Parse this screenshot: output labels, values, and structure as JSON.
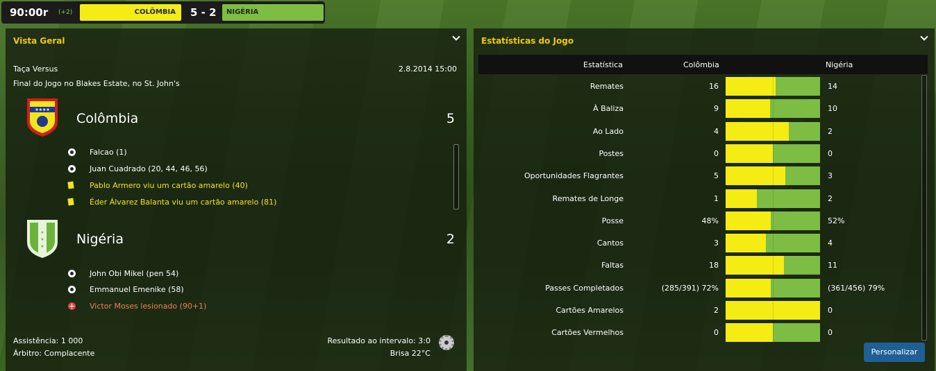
{
  "scorebar": {
    "time": "90:00r",
    "added": "(+2)",
    "home_team": "COLÔMBIA",
    "away_team": "NIGÉRIA",
    "score": "5 - 2"
  },
  "overview": {
    "title": "Vista Geral",
    "competition": "Taça Versus",
    "datetime": "2.8.2014 15:00",
    "venue": "Final do Jogo no Blakes Estate, no St. John's",
    "home": {
      "name": "Colômbia",
      "score": "5",
      "events": [
        {
          "type": "goal",
          "text": "Falcao (1)"
        },
        {
          "type": "goal",
          "text": "Juan Cuadrado (20, 44, 46, 56)"
        },
        {
          "type": "yellow",
          "text": "Pablo Armero viu um cartão amarelo (40)"
        },
        {
          "type": "yellow",
          "text": "Éder Álvarez Balanta viu um cartão amarelo (81)"
        }
      ]
    },
    "away": {
      "name": "Nigéria",
      "score": "2",
      "events": [
        {
          "type": "goal",
          "text": "John Obi Mikel (pen 54)"
        },
        {
          "type": "goal",
          "text": "Emmanuel Emenike (58)"
        },
        {
          "type": "injury",
          "text": "Victor Moses lesionado (90+1)"
        }
      ]
    },
    "attendance": "Assistência: 1 000",
    "referee": "Árbitro: Complacente",
    "halftime": "Resultado ao intervalo: 3:0",
    "weather": "Brisa 22°C"
  },
  "stats": {
    "title": "Estatísticas do Jogo",
    "headers": {
      "stat": "Estatística",
      "home": "Colômbia",
      "away": "Nigéria"
    },
    "rows": [
      {
        "label": "Remates",
        "home": "16",
        "away": "14",
        "home_share": 0.53
      },
      {
        "label": "À Baliza",
        "home": "9",
        "away": "10",
        "home_share": 0.47
      },
      {
        "label": "Ao Lado",
        "home": "4",
        "away": "2",
        "home_share": 0.67
      },
      {
        "label": "Postes",
        "home": "0",
        "away": "0",
        "home_share": 0.5
      },
      {
        "label": "Oportunidades Flagrantes",
        "home": "5",
        "away": "3",
        "home_share": 0.63
      },
      {
        "label": "Remates de Longe",
        "home": "1",
        "away": "2",
        "home_share": 0.33
      },
      {
        "label": "Posse",
        "home": "48%",
        "away": "52%",
        "home_share": 0.48
      },
      {
        "label": "Cantos",
        "home": "3",
        "away": "4",
        "home_share": 0.43
      },
      {
        "label": "Faltas",
        "home": "18",
        "away": "11",
        "home_share": 0.62
      },
      {
        "label": "Passes Completados",
        "home": "(285/391) 72%",
        "away": "(361/456) 79%",
        "home_share": 0.48
      },
      {
        "label": "Cartões Amarelos",
        "home": "2",
        "away": "0",
        "home_share": 1.0
      },
      {
        "label": "Cartões Vermelhos",
        "home": "0",
        "away": "0",
        "home_share": 0.5
      }
    ],
    "customize_label": "Personalizar"
  },
  "colors": {
    "home": "#f4ec13",
    "away": "#7dbd43",
    "accent_title": "#f4c80e",
    "button": "#1f5f96"
  }
}
